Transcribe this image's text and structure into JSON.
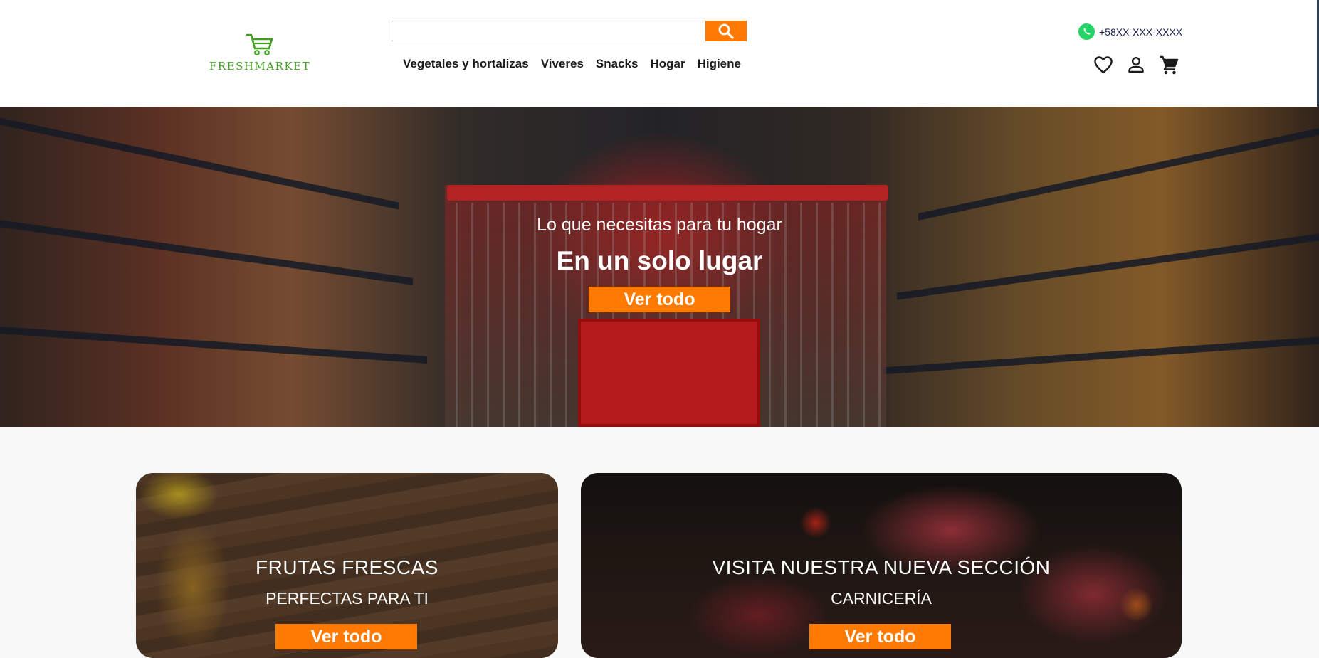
{
  "brand": {
    "name": "FRESHMARKET"
  },
  "search": {
    "placeholder": "",
    "value": ""
  },
  "nav": {
    "items": [
      {
        "label": "Vegetales y hortalizas"
      },
      {
        "label": "Viveres"
      },
      {
        "label": "Snacks"
      },
      {
        "label": "Hogar"
      },
      {
        "label": "Higiene"
      }
    ]
  },
  "contact": {
    "phone": "+58XX-XXX-XXXX",
    "icon": "whatsapp-icon"
  },
  "header_icons": [
    "heart-icon",
    "user-icon",
    "cart-icon"
  ],
  "hero": {
    "subtitle": "Lo que necesitas para tu hogar",
    "title": "En un solo lugar",
    "button_label": "Ver todo"
  },
  "promos": [
    {
      "title": "FRUTAS FRESCAS",
      "subtitle": "PERFECTAS PARA TI",
      "button_label": "Ver todo"
    },
    {
      "title": "VISITA NUESTRA NUEVA SECCIÓN",
      "subtitle": "CARNICERÍA",
      "button_label": "Ver todo"
    }
  ],
  "colors": {
    "accent": "#ff7a00",
    "brand_green": "#3fa01e",
    "whatsapp_green": "#25d366",
    "text_dark": "#1b1b1b",
    "phone_text": "#1d2450"
  }
}
